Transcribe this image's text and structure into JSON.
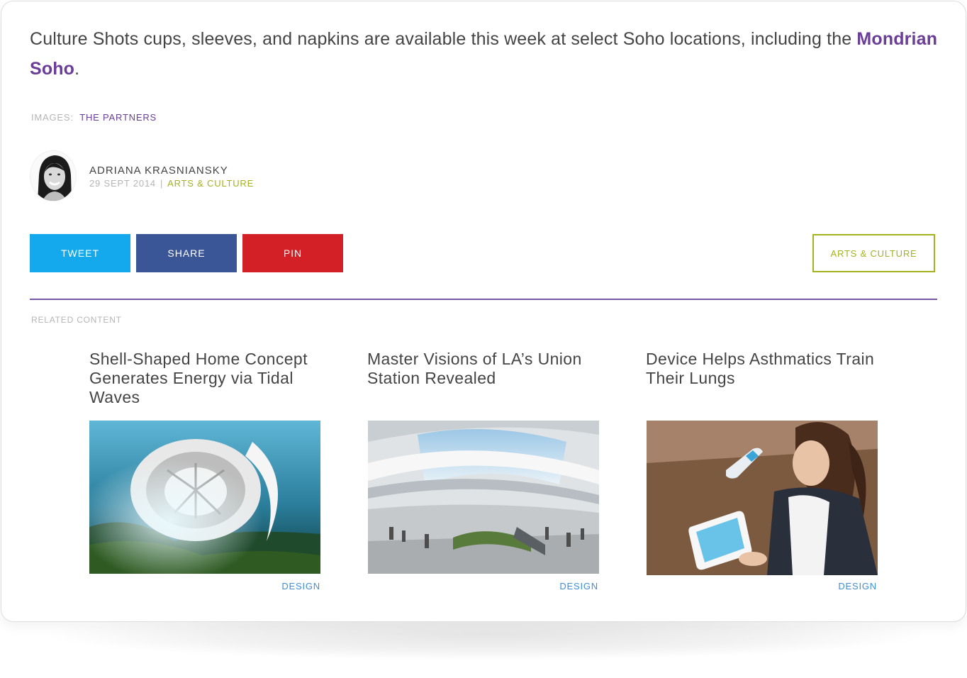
{
  "article": {
    "lead_text": "Culture Shots cups, sleeves, and napkins are available this week at select Soho locations, including the ",
    "lead_link": "Mondrian Soho",
    "lead_end": "."
  },
  "credits": {
    "label": "IMAGES:",
    "value": "THE PARTNERS"
  },
  "author": {
    "name": "ADRIANA KRASNIANSKY",
    "date": "29 SEPT 2014",
    "separator": "|",
    "category": "ARTS & CULTURE"
  },
  "share": {
    "tweet": "TWEET",
    "share": "SHARE",
    "pin": "PIN"
  },
  "category_button": "ARTS & CULTURE",
  "colors": {
    "accent_purple": "#6a3e98",
    "accent_green": "#a4b21e",
    "twitter": "#14a8ec",
    "facebook": "#3b5697",
    "pinterest": "#d31f26",
    "link_blue": "#3f8ed8"
  },
  "related": {
    "label": "RELATED CONTENT",
    "items": [
      {
        "title": "Shell-Shaped Home Concept Generates Energy via Tidal Waves",
        "category": "DESIGN"
      },
      {
        "title": "Master Visions of LA’s Union Station Revealed",
        "category": "DESIGN"
      },
      {
        "title": "Device Helps Asthmatics Train Their Lungs",
        "category": "DESIGN"
      }
    ]
  }
}
